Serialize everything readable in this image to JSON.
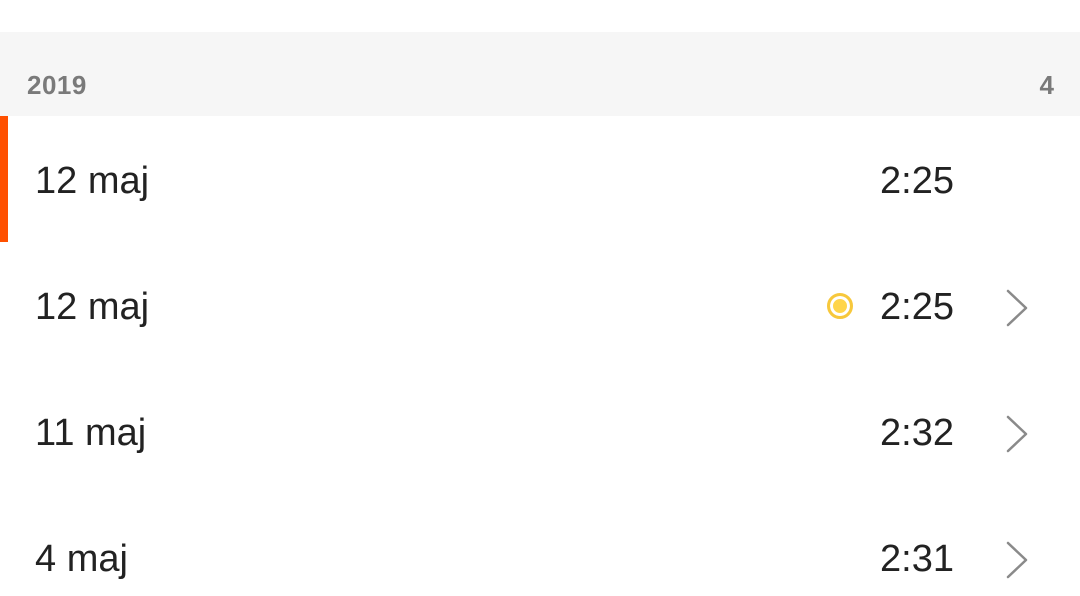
{
  "header": {
    "year": "2019",
    "count": "4"
  },
  "colors": {
    "accent": "#ff5000",
    "marker": "#f7c83c",
    "marker_inner": "#ffd54a"
  },
  "rows": [
    {
      "date": "12 maj",
      "time": "2:25",
      "selected": true,
      "has_marker": false,
      "has_chevron": false
    },
    {
      "date": "12 maj",
      "time": "2:25",
      "selected": false,
      "has_marker": true,
      "has_chevron": true
    },
    {
      "date": "11 maj",
      "time": "2:32",
      "selected": false,
      "has_marker": false,
      "has_chevron": true
    },
    {
      "date": "4 maj",
      "time": "2:31",
      "selected": false,
      "has_marker": false,
      "has_chevron": true
    }
  ]
}
